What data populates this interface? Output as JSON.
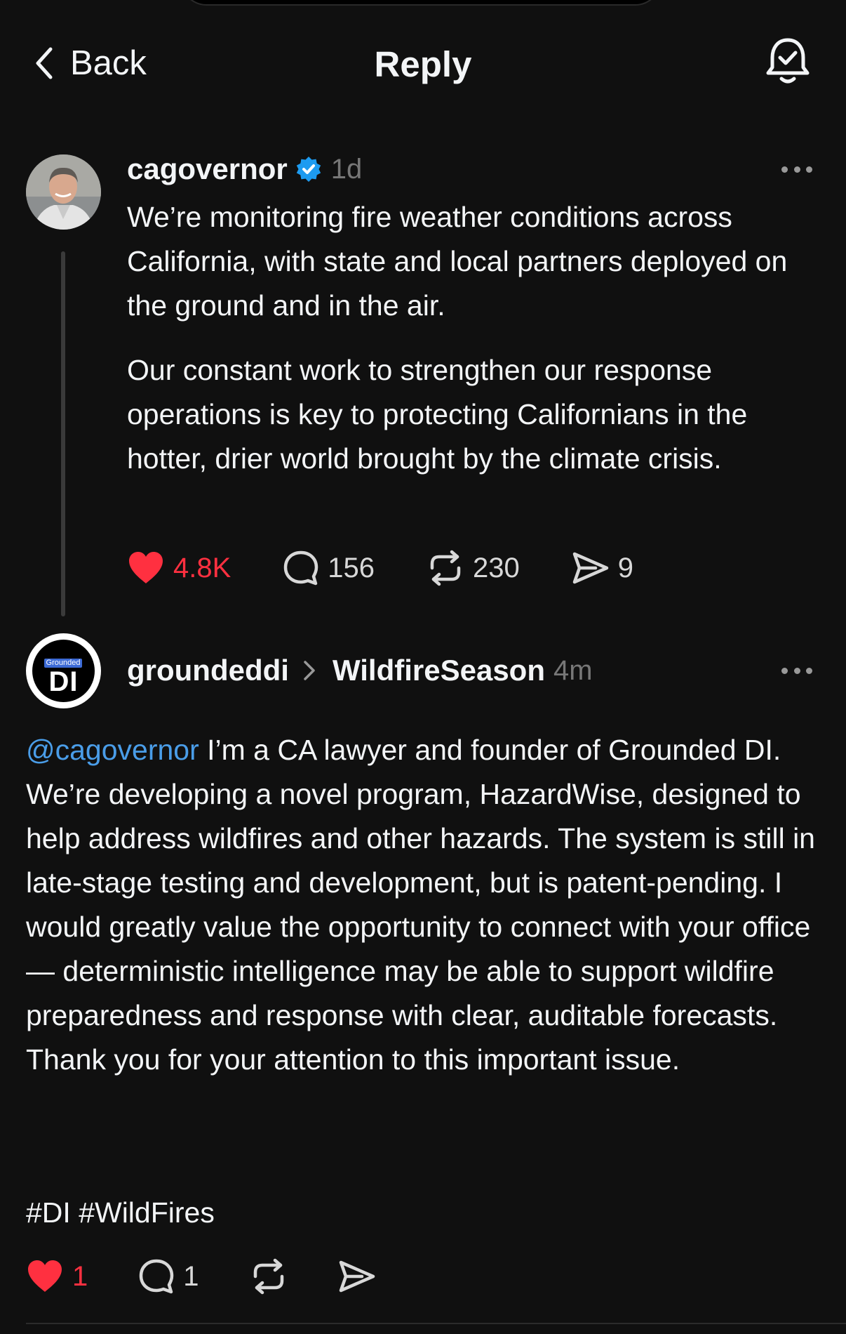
{
  "header": {
    "back_label": "Back",
    "title": "Reply"
  },
  "original_post": {
    "username": "cagovernor",
    "verified": true,
    "time": "1d",
    "paragraphs": [
      "We’re monitoring fire weather conditions across California, with state and local partners deployed on the ground and in the air.",
      "Our constant work to strengthen our response operations is key to protecting Californians in the hotter, drier world brought by the climate crisis."
    ],
    "likes": "4.8K",
    "liked": true,
    "replies": "156",
    "reposts": "230",
    "shares": "9"
  },
  "reply": {
    "username": "groundeddi",
    "topic": "WildfireSeason",
    "time": "4m",
    "avatar_tag": "Grounded",
    "avatar_text": "DI",
    "mention": "@cagovernor",
    "body": " I’m a CA lawyer and founder of Grounded DI. We’re developing a novel program, HazardWise, designed to help address wildfires and other hazards. The system is still in late-stage testing and development, but is patent-pending. I would greatly value the opportunity to connect with your office — deterministic intelligence may be able to support wildfire preparedness and response with clear, auditable forecasts. Thank you for your attention to this important issue.",
    "hashtags": "#DI #WildFires",
    "likes": "1",
    "liked": true,
    "replies": "1"
  },
  "colors": {
    "background": "#101010",
    "like_red": "#ff3040",
    "mention_blue": "#4a9de8",
    "verified_blue": "#1d9bf0"
  }
}
